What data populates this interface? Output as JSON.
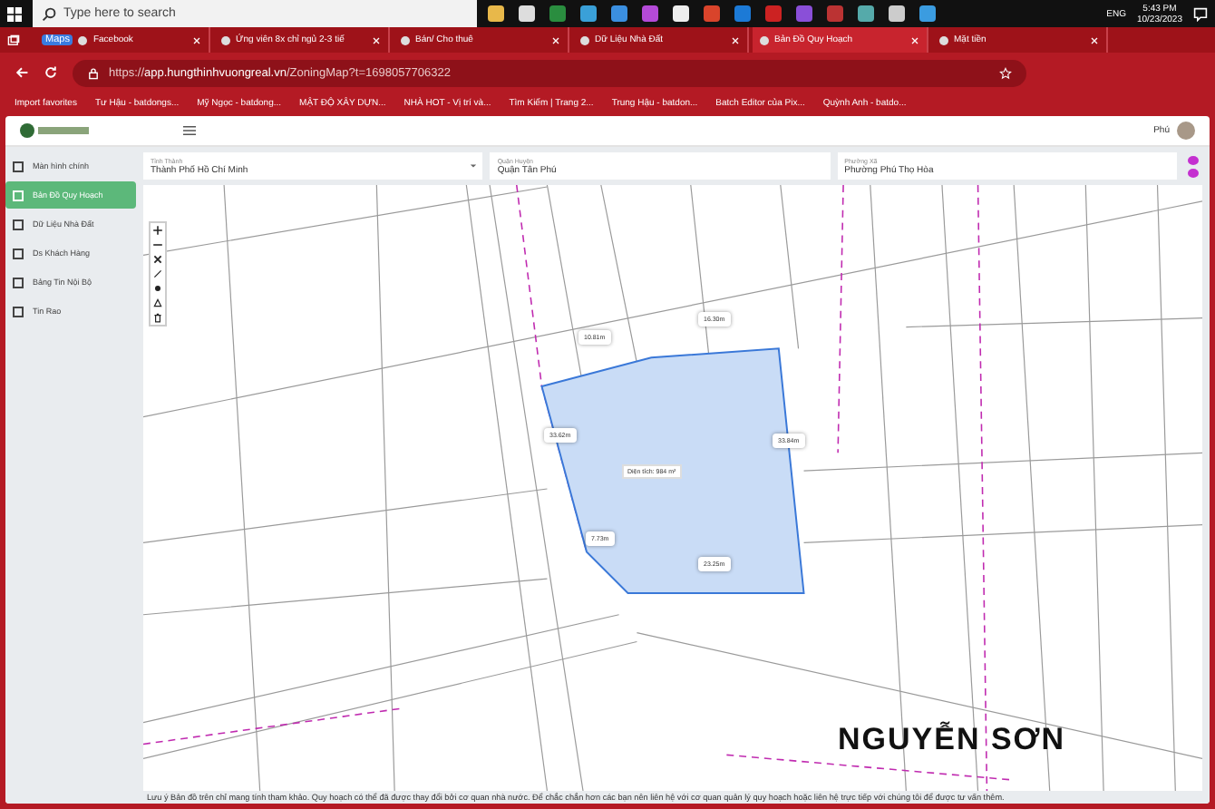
{
  "taskbar": {
    "search_placeholder": "Type here to search",
    "language": "ENG",
    "time": "5:43 PM",
    "date": "10/23/2023"
  },
  "browser_tabs": [
    {
      "label": "Facebook",
      "badge": "Maps",
      "selected": false
    },
    {
      "label": "Ứng viên 8x chỉ ngủ 2-3 tiế",
      "selected": false
    },
    {
      "label": "Bán/ Cho thuê",
      "selected": false
    },
    {
      "label": "Dữ Liệu Nhà Đất",
      "selected": false
    },
    {
      "label": "Bản Đồ Quy Hoạch",
      "selected": true
    },
    {
      "label": "Mặt tiền",
      "selected": false
    }
  ],
  "address_bar": {
    "url_prefix": "https://",
    "url_host": "app.hungthinhvuongreal.vn",
    "url_path": "/ZoningMap?t=1698057706322"
  },
  "bookmarks": [
    "Import favorites",
    "Tư Hậu - batdongs...",
    "Mỹ Ngọc - batdong...",
    "MẬT ĐỘ XÂY DỰN...",
    "NHÀ HOT - Vị trí và...",
    "Tìm Kiếm | Trang 2...",
    "Trung Hậu - batdon...",
    "Batch Editor của Pix...",
    "Quỳnh Anh - batdo..."
  ],
  "app_header": {
    "user_name": "Phú"
  },
  "sidebar": {
    "items": [
      {
        "label": "Màn hình chính",
        "selected": false
      },
      {
        "label": "Bản Đồ Quy Hoạch",
        "selected": true
      },
      {
        "label": "Dữ Liệu Nhà Đất",
        "selected": false
      },
      {
        "label": "Ds Khách Hàng",
        "selected": false
      },
      {
        "label": "Bảng Tin Nội Bộ",
        "selected": false
      },
      {
        "label": "Tin Rao",
        "selected": false
      }
    ]
  },
  "filters": [
    {
      "label": "Tỉnh Thành",
      "value": "Thành Phố Hồ Chí Minh"
    },
    {
      "label": "Quận Huyện",
      "value": "Quận Tân Phú"
    },
    {
      "label": "Phường Xã",
      "value": "Phường Phú Thọ Hòa"
    }
  ],
  "map": {
    "area_label": "Diện tích: 984 m²",
    "measurements": [
      "10.81m",
      "16.30m",
      "33.62m",
      "33.84m",
      "7.73m",
      "23.25m"
    ],
    "street_name": "NGUYỄN SƠN"
  },
  "footer_note": "Lưu ý Bản đồ trên chỉ mang tính tham khảo. Quy hoạch có thể đã được thay đổi bởi cơ quan nhà nước. Để chắc chắn hơn các bạn nên liên hệ với cơ quan quản lý quy hoạch hoặc liên hệ trực tiếp với chúng tôi để được tư vấn thêm."
}
